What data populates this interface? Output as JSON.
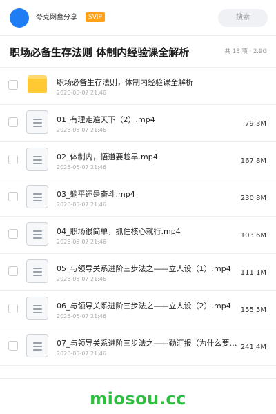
{
  "header": {
    "share_name": "夸克网盘分享",
    "badge": "SVIP",
    "search_placeholder": "搜索"
  },
  "title_bar": {
    "title": "职场必备生存法则 体制内经验课全解析",
    "meta": "共 18 项 · 2.9G"
  },
  "items": [
    {
      "type": "folder",
      "icon": "folder-icon",
      "name": "职场必备生存法则，体制内经验课全解析",
      "date": "2026-05-07 21:46",
      "size": ""
    },
    {
      "type": "file",
      "icon": "file-icon",
      "name": "01_有理走遍天下（2）.mp4",
      "date": "2026-05-07 21:46",
      "size": "79.3M"
    },
    {
      "type": "file",
      "icon": "file-icon",
      "name": "02_体制内，悟道要趁早.mp4",
      "date": "2026-05-07 21:46",
      "size": "167.8M"
    },
    {
      "type": "file",
      "icon": "file-icon",
      "name": "03_躺平还是奋斗.mp4",
      "date": "2026-05-07 21:46",
      "size": "230.8M"
    },
    {
      "type": "file",
      "icon": "file-icon",
      "name": "04_职场很简单，抓住核心就行.mp4",
      "date": "2026-05-07 21:46",
      "size": "103.6M"
    },
    {
      "type": "file",
      "icon": "file-icon",
      "name": "05_与领导关系进阶三步法之——立人设（1）.mp4",
      "date": "2026-05-07 21:46",
      "size": "111.1M"
    },
    {
      "type": "file",
      "icon": "file-icon",
      "name": "06_与领导关系进阶三步法之——立人设（2）.mp4",
      "date": "2026-05-07 21:46",
      "size": "155.5M"
    },
    {
      "type": "file",
      "icon": "file-icon",
      "name": "07_与领导关系进阶三步法之——勤汇报（为什么要勤…",
      "date": "2026-05-07 21:46",
      "size": "241.4M"
    }
  ],
  "brand": {
    "watermark": "miosou.cc",
    "color": "#2fbf3f"
  }
}
